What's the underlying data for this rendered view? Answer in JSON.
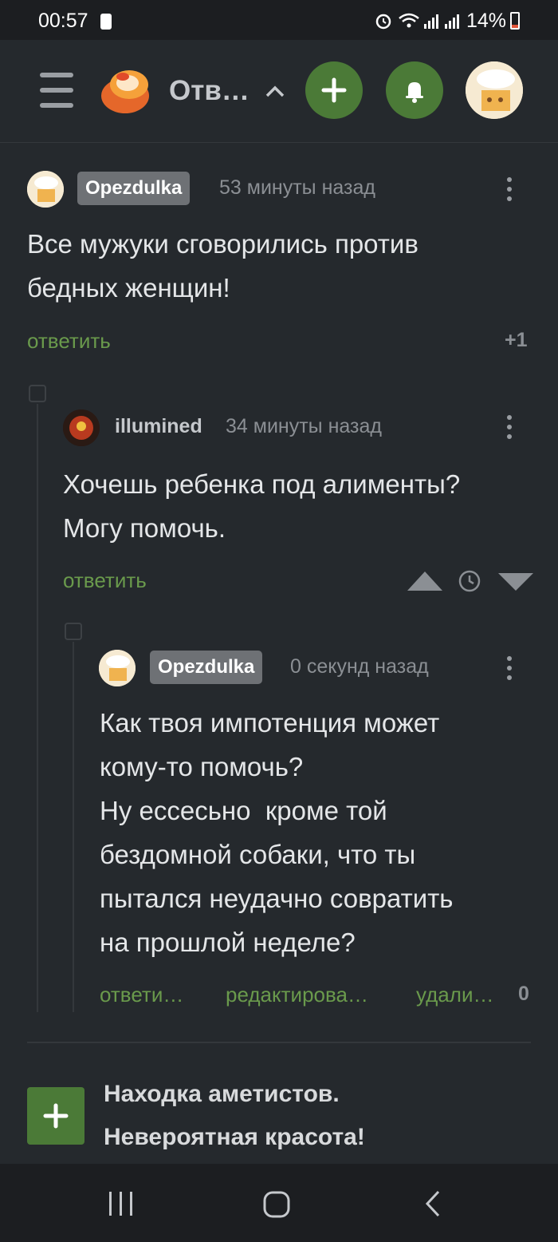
{
  "status": {
    "time": "00:57",
    "battery": "14%"
  },
  "header": {
    "title": "Отв…",
    "menu_icon": "menu-icon",
    "logo": "pikabu-logo",
    "add_icon": "plus-icon",
    "bell_icon": "bell-icon"
  },
  "comments": [
    {
      "author": "Opezdulka",
      "time": "53 минуты назад",
      "text_lines": [
        "Все мужуки сговорились против",
        "бедных женщин!"
      ],
      "reply_label": "ответить",
      "rating": "+1"
    },
    {
      "author": "illumined",
      "time": "34 минуты назад",
      "text_lines": [
        "Хочешь ребенка под алименты?",
        "Могу помочь."
      ],
      "reply_label": "ответить"
    },
    {
      "author": "Opezdulka",
      "time": "0 секунд назад",
      "text_lines": [
        "Как твоя импотенция может",
        "кому-то помочь?",
        "Ну ессесьно  кроме той",
        "бездомной собаки, что ты",
        "пытался неудачно совратить",
        "на прошлой неделе?"
      ],
      "reply_label": "ответи…",
      "edit_label": "редактирова…",
      "delete_label": "удали…",
      "rating": "0"
    }
  ],
  "story": {
    "title_lines": [
      "Находка аметистов.",
      "Невероятная красота!"
    ]
  },
  "colors": {
    "accent_green": "#4b7a37",
    "link_green": "#6a9a4c",
    "background": "#25292d"
  }
}
